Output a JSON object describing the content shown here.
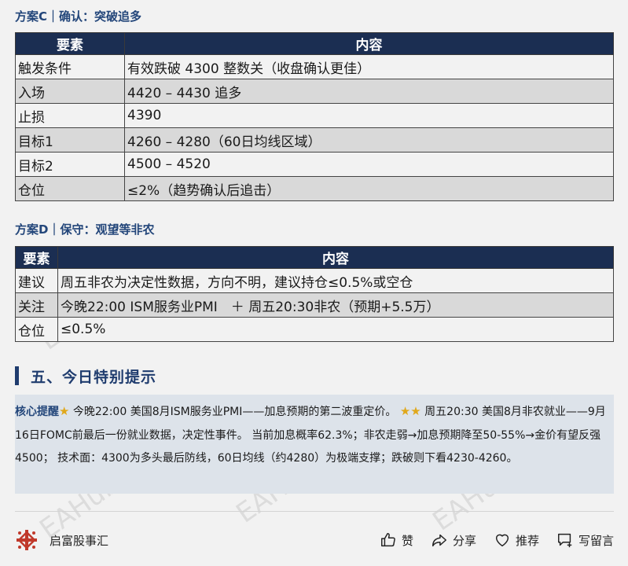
{
  "plan_c": {
    "title": "方案C｜确认：突破追多",
    "headers": [
      "要素",
      "内容"
    ],
    "rows": [
      {
        "k": "触发条件",
        "v": "有效跌破 4300 整数关（收盘确认更佳）"
      },
      {
        "k": "入场",
        "v": "4420 – 4430 追多"
      },
      {
        "k": "止损",
        "v": "4390"
      },
      {
        "k": "目标1",
        "v": "4260 – 4280（60日均线区域）"
      },
      {
        "k": "目标2",
        "v": "4500 – 4520"
      },
      {
        "k": "仓位",
        "v": "≤2%（趋势确认后追击）"
      }
    ]
  },
  "plan_d": {
    "title": "方案D｜保守：观望等非农",
    "headers": [
      "要素",
      "内容"
    ],
    "rows": [
      {
        "k": "建议",
        "v": "周五非农为决定性数据，方向不明，建议持仓≤0.5%或空仓"
      },
      {
        "k": "关注",
        "v": "今晚22:00 ISM服务业PMI　＋ 周五20:30非农（预期+5.5万）"
      },
      {
        "k": "仓位",
        "v": "≤0.5%"
      }
    ]
  },
  "section5": {
    "heading": "五、今日特别提示"
  },
  "tip": {
    "label": "核心提醒",
    "part1": " 今晚22:00 美国8月ISM服务业PMI——加息预期的第二波重定价。 ",
    "part2": " 周五20:30 美国8月非农就业——9月16日FOMC前最后一份就业数据，决定性事件。 当前加息概率62.3%；非农走弱→加息预期降至50-55%→金价有望反强4500； 技术面：4300为多头最后防线，60日均线（约4280）为极端支撑；跌破则下看4230-4260。"
  },
  "footer": {
    "account": "启富股事汇",
    "like": "赞",
    "share": "分享",
    "recommend": "推荐",
    "comment": "写留言"
  },
  "watermark": "EAHub.cn",
  "colors": {
    "header_bg": "#1b2e52",
    "title_blue": "#23467a",
    "star": "#e0a81b",
    "tip_bg": "#dde3ea",
    "logo_red": "#c0392b"
  }
}
